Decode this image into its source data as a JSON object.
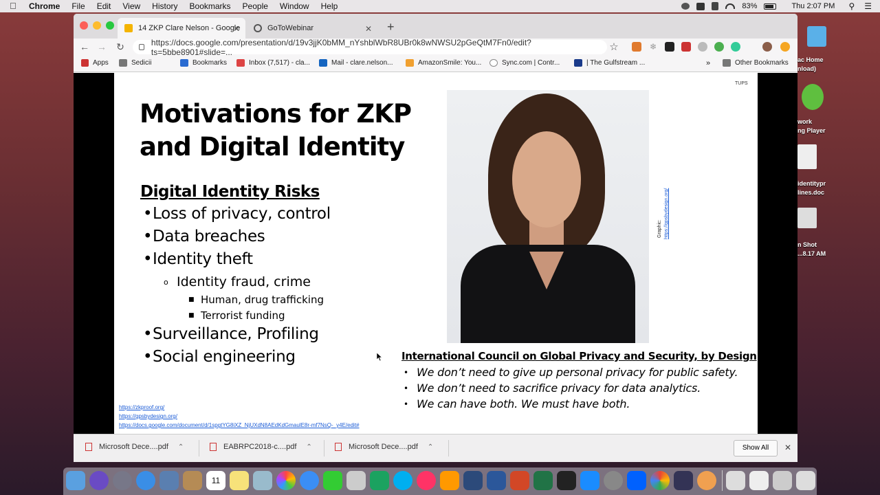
{
  "menubar": {
    "app": "Chrome",
    "menus": [
      "File",
      "Edit",
      "View",
      "History",
      "Bookmarks",
      "People",
      "Window",
      "Help"
    ],
    "battery": "83%",
    "clock": "Thu 2:07 PM"
  },
  "browser": {
    "tabs": [
      {
        "title": "14 ZKP Clare Nelson - Google",
        "active": true
      },
      {
        "title": "GoToWebinar",
        "active": false
      }
    ],
    "url": "https://docs.google.com/presentation/d/19v3jjK0bMM_nYshblWbR8UBr0k8wNWSU2pGeQtM7Fn0/edit?ts=5bbe8901#slide=...",
    "bookmarks": [
      "Apps",
      "Sedicii",
      "Bookmarks",
      "Inbox (7,517) - cla...",
      "Mail - clare.nelson...",
      "AmazonSmile: You...",
      "Sync.com | Contr...",
      "| The Gulfstream ..."
    ],
    "bookmarks_overflow": "»",
    "other_bookmarks": "Other Bookmarks"
  },
  "slide": {
    "title_line1": "Motivations for ZKP",
    "title_line2": "and Digital Identity",
    "risks_heading": "Digital Identity Risks",
    "risks": [
      "Loss of privacy, control",
      "Data breaches",
      "Identity theft",
      "Identity fraud, crime",
      "Human, drug trafficking",
      "Terrorist funding",
      "Surveillance, Profiling",
      "Social engineering"
    ],
    "graphic_label": "Graphic:",
    "graphic_url": "https://gpsbydesign.org/",
    "tups": "TUPS",
    "council_heading": "International Council on Global Privacy and Security, by Design",
    "council_points": [
      "We don’t need to give up personal privacy for public safety.",
      "We don’t need to sacrifice privacy for data analytics.",
      "We can have both. We must have both."
    ],
    "links": [
      "https://zkproof.org/",
      "https://gpsbydesign.org/",
      "https://docs.google.com/document/d/1spgtYG8iXZ_NjUXdN8AEdKdGmaulE8r-mf7NsQ-_y4E/edit#"
    ]
  },
  "downloads": {
    "items": [
      "Microsoft Dece....pdf",
      "EABRPC2018-c....pdf",
      "Microsoft Dece....pdf"
    ],
    "show_all": "Show All"
  },
  "desktop_right": {
    "item1": "ac Home",
    "item1b": "nload)",
    "item2": "work",
    "item2b": "ng Player",
    "item3": "identitypr",
    "item3b": "lines.doc",
    "item4": "n Shot",
    "item4b": "...8.17 AM"
  },
  "dock": {
    "calendar_day": "11"
  }
}
